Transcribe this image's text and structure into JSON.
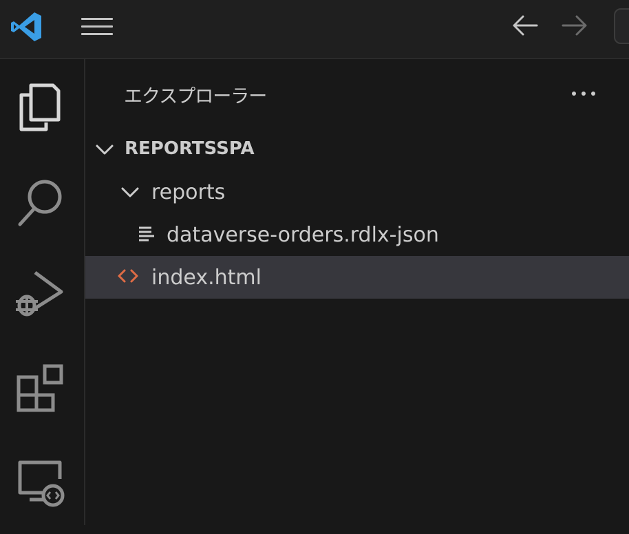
{
  "titlebar": {
    "logo_icon": "vscode-logo-icon",
    "menu_icon": "hamburger-menu-icon",
    "back_icon": "arrow-left-icon",
    "forward_icon": "arrow-right-icon"
  },
  "activitybar": {
    "items": [
      {
        "id": "explorer",
        "icon": "files-icon",
        "active": true
      },
      {
        "id": "search",
        "icon": "search-icon",
        "active": false
      },
      {
        "id": "run-debug",
        "icon": "run-debug-icon",
        "active": false
      },
      {
        "id": "extensions",
        "icon": "extensions-icon",
        "active": false
      },
      {
        "id": "remote-explorer",
        "icon": "remote-explorer-icon",
        "active": false
      }
    ]
  },
  "sidebar": {
    "title": "エクスプローラー",
    "more_icon": "ellipsis-icon",
    "workspace": {
      "name": "REPORTSSPA",
      "expanded": true
    },
    "tree": [
      {
        "label": "reports",
        "type": "folder",
        "expanded": true,
        "depth": 1
      },
      {
        "label": "dataverse-orders.rdlx-json",
        "type": "file",
        "icon": "file-text-icon",
        "depth": 2
      },
      {
        "label": "index.html",
        "type": "file",
        "icon": "html-code-icon",
        "depth": 1,
        "selected": true
      }
    ]
  },
  "colors": {
    "background": "#181818",
    "titlebar": "#1f1f1f",
    "selection": "#37373d",
    "text": "#cccccc",
    "vscode_blue": "#3a9ee6",
    "html_icon": "#e06c45"
  }
}
